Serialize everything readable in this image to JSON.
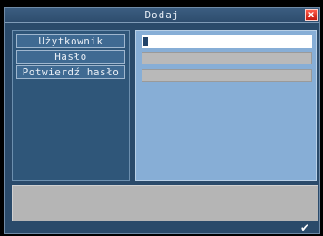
{
  "window": {
    "title": "Dodaj",
    "close_label": "x"
  },
  "labels": {
    "user": "Użytkownik",
    "password": "Hasło",
    "confirm_password": "Potwierdź hasło"
  },
  "fields": {
    "user_value": "",
    "password_value": "",
    "confirm_value": ""
  },
  "message": "",
  "ok_icon": "✔"
}
